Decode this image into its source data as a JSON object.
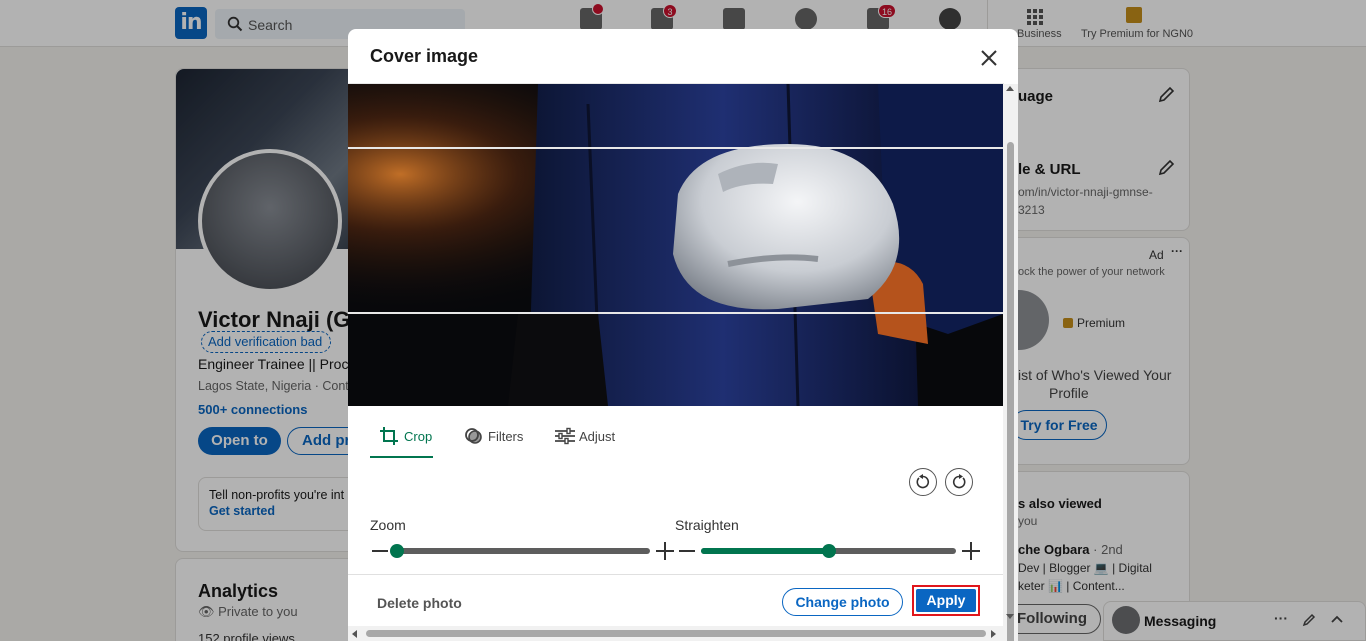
{
  "navbar": {
    "logo": "in",
    "search_placeholder": "Search",
    "badges": {
      "network": "3",
      "notifications": "16"
    },
    "business_label": "Business",
    "premium_label": "Try Premium for NGN0"
  },
  "profile": {
    "name": "Victor Nnaji (GN",
    "verify_label": "Add verification bad",
    "headline": "Engineer Trainee || Proce",
    "location": "Lagos State, Nigeria · Conta",
    "connections": "500+ connections",
    "open_to": "Open to",
    "add_profile": "Add pro",
    "nonprofit_text": "Tell non-profits you're int",
    "get_started": "Get started"
  },
  "analytics": {
    "title": "Analytics",
    "private": "Private to you",
    "profile_views": "152 profile views"
  },
  "right_rail": {
    "language": "uage",
    "profile_url_title": "le & URL",
    "profile_url_1": "om/in/victor-nnaji-gmnse-",
    "profile_url_2": "3213",
    "ad_label": "Ad",
    "ad_tagline": "ock the power of your network",
    "premium": "Premium",
    "ad_body_1": "ist of Who's Viewed Your",
    "ad_body_2": "Profile",
    "try_free": "Try for Free",
    "also_viewed": "s also viewed",
    "also_viewed_sub": "you",
    "person_name": "che Ogbara",
    "person_degree": "· 2nd",
    "person_line2": "Dev | Blogger 💻 | Digital",
    "person_line3": "keter 📊 | Content...",
    "following": "Following"
  },
  "messaging": {
    "label": "Messaging"
  },
  "modal": {
    "title": "Cover image",
    "tabs": [
      {
        "label": "Crop",
        "icon": "crop-icon",
        "active": true
      },
      {
        "label": "Filters",
        "icon": "filters-icon",
        "active": false
      },
      {
        "label": "Adjust",
        "icon": "adjust-icon",
        "active": false
      }
    ],
    "sliders": {
      "zoom": {
        "label": "Zoom",
        "value_fraction": 0.0
      },
      "straighten": {
        "label": "Straighten",
        "value_fraction": 0.5
      }
    },
    "buttons": {
      "delete": "Delete photo",
      "change": "Change photo",
      "apply": "Apply"
    },
    "accent_color": "#01754f",
    "primary_color": "#0a66c2"
  }
}
